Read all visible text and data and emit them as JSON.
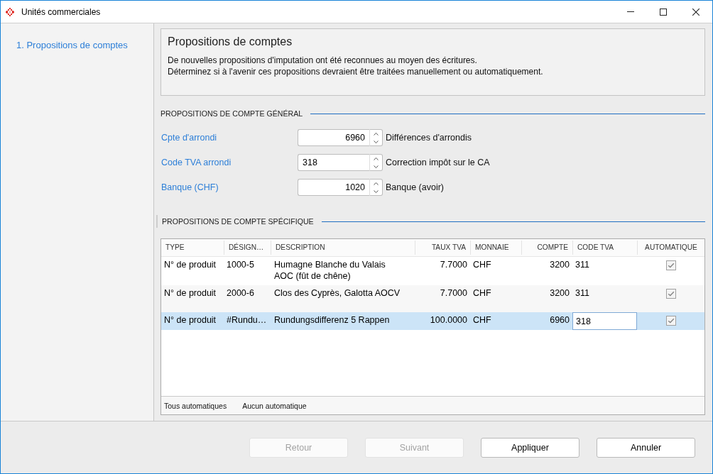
{
  "window": {
    "title": "Unités commerciales"
  },
  "sidebar": {
    "items": [
      {
        "label": "1. Propositions de comptes",
        "selected": true
      }
    ]
  },
  "header": {
    "title": "Propositions de comptes",
    "lines": [
      "De nouvelles propositions d'imputation ont été reconnues au moyen des écritures.",
      "Déterminez si à l'avenir ces propositions devraient être traitées manuellement ou automatiquement."
    ]
  },
  "general": {
    "title": "PROPOSITIONS DE COMPTE GÉNÉRAL",
    "fields": [
      {
        "label": "Cpte d'arrondi",
        "kind": "number",
        "value": "6960",
        "description": "Différences d'arrondis"
      },
      {
        "label": "Code TVA arrondi",
        "kind": "code",
        "value": "318",
        "description": "Correction impôt sur le CA"
      },
      {
        "label": "Banque (CHF)",
        "kind": "number",
        "value": "1020",
        "description": "Banque (avoir)"
      }
    ]
  },
  "specific": {
    "title": "PROPOSITIONS DE COMPTE SPÉCIFIQUE",
    "table": {
      "columns": [
        {
          "label": "TYPE",
          "kind": "text"
        },
        {
          "label": "DÉSIGN…",
          "kind": "text"
        },
        {
          "label": "DESCRIPTION",
          "kind": "text"
        },
        {
          "label": "TAUX TVA",
          "kind": "number"
        },
        {
          "label": "MONNAIE",
          "kind": "text"
        },
        {
          "label": "COMPTE",
          "kind": "number"
        },
        {
          "label": "CODE TVA",
          "kind": "code"
        },
        {
          "label": "AUTOMATIQUE",
          "kind": "check"
        }
      ],
      "rows": [
        {
          "cells": [
            "N° de produit",
            "1000-5",
            "Humagne Blanche du Valais AOC (fût de chêne)",
            "7.7000",
            "CHF",
            "3200",
            "311"
          ],
          "automatic": true,
          "selected": false,
          "editing": false
        },
        {
          "cells": [
            "N° de produit",
            "2000-6",
            "Clos des Cyprès, Galotta AOCV",
            "7.7000",
            "CHF",
            "3200",
            "311"
          ],
          "automatic": true,
          "selected": false,
          "editing": false
        },
        {
          "cells": [
            "N° de produit",
            "#Rundu…",
            "Rundungsdifferenz 5 Rappen",
            "100.0000",
            "CHF",
            "6960",
            "318"
          ],
          "automatic": true,
          "selected": true,
          "editing": true
        }
      ]
    },
    "actions": [
      "Tous automatiques",
      "Aucun automatique"
    ]
  },
  "buttons": [
    {
      "label": "Retour",
      "disabled": true
    },
    {
      "label": "Suivant",
      "disabled": true
    },
    {
      "label": "Appliquer",
      "disabled": false
    },
    {
      "label": "Annuler",
      "disabled": false
    }
  ]
}
